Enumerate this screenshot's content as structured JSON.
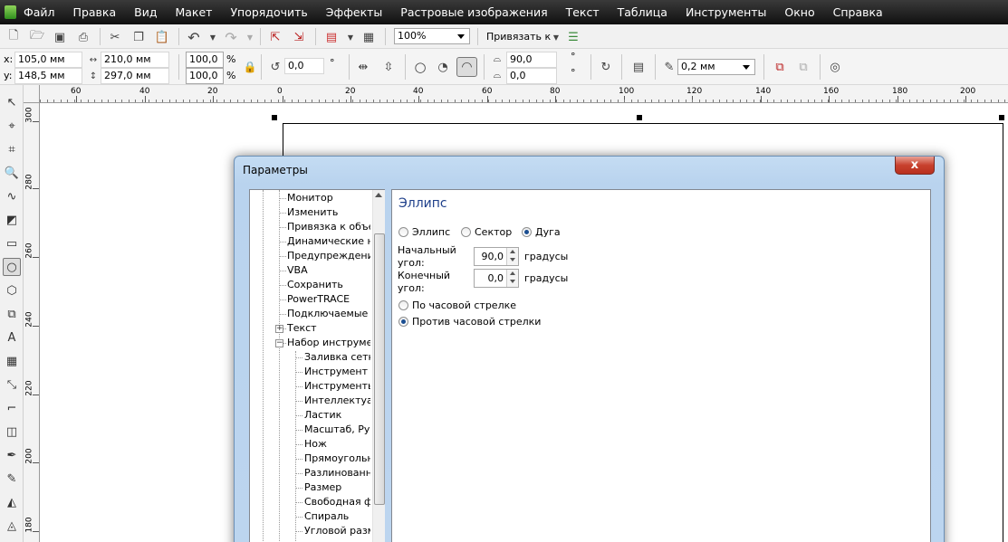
{
  "menu": [
    "Файл",
    "Правка",
    "Вид",
    "Макет",
    "Упорядочить",
    "Эффекты",
    "Растровые изображения",
    "Текст",
    "Таблица",
    "Инструменты",
    "Окно",
    "Справка"
  ],
  "toolbar": {
    "zoom_value": "100%",
    "snap_label": "Привязать к"
  },
  "propbar": {
    "x": "105,0 мм",
    "y": "148,5 мм",
    "width": "210,0 мм",
    "height": "297,0 мм",
    "scale_x": "100,0",
    "scale_y": "100,0",
    "percent": "%",
    "rotation": "0,0",
    "degree": "°",
    "start_angle": "90,0",
    "end_angle": "0,0",
    "outline": "0,2 мм"
  },
  "hruler_ticks": [
    "60",
    "40",
    "20",
    "0",
    "20",
    "40",
    "60",
    "80",
    "100",
    "120",
    "140",
    "160",
    "180",
    "200"
  ],
  "vruler_ticks": [
    "300",
    "280",
    "260",
    "240",
    "220",
    "200",
    "180"
  ],
  "dialog": {
    "title": "Параметры",
    "close": "x",
    "tree": [
      {
        "label": "Монитор",
        "level": 1
      },
      {
        "label": "Изменить",
        "level": 1
      },
      {
        "label": "Привязка к объек",
        "level": 1
      },
      {
        "label": "Динамические нап",
        "level": 1
      },
      {
        "label": "Предупреждения",
        "level": 1
      },
      {
        "label": "VBA",
        "level": 1
      },
      {
        "label": "Сохранить",
        "level": 1
      },
      {
        "label": "PowerTRACE",
        "level": 1
      },
      {
        "label": "Подключаемые мо",
        "level": 1
      },
      {
        "label": "Текст",
        "level": 1,
        "toggle": "+"
      },
      {
        "label": "Набор инструмент",
        "level": 1,
        "toggle": "−"
      },
      {
        "label": "Заливка сетк",
        "level": 2
      },
      {
        "label": "Инструмент со",
        "level": 2
      },
      {
        "label": "Инструменты",
        "level": 2
      },
      {
        "label": "Интеллектуал",
        "level": 2
      },
      {
        "label": "Ластик",
        "level": 2
      },
      {
        "label": "Масштаб, Рук",
        "level": 2
      },
      {
        "label": "Нож",
        "level": 2
      },
      {
        "label": "Прямоугольни",
        "level": 2
      },
      {
        "label": "Разлинованна",
        "level": 2
      },
      {
        "label": "Размер",
        "level": 2
      },
      {
        "label": "Свободная фо",
        "level": 2
      },
      {
        "label": "Спираль",
        "level": 2
      },
      {
        "label": "Угловой разме",
        "level": 2
      }
    ],
    "panel": {
      "title": "Эллипс",
      "radio_ellipse": "Эллипс",
      "radio_sector": "Сектор",
      "radio_arc": "Дуга",
      "start_label_1": "Начальный",
      "start_label_2": "угол:",
      "start_value": "90,0",
      "end_label_1": "Конечный",
      "end_label_2": "угол:",
      "end_value": "0,0",
      "units": "градусы",
      "clockwise": "По часовой стрелке",
      "counterclockwise": "Против часовой стрелки"
    }
  }
}
